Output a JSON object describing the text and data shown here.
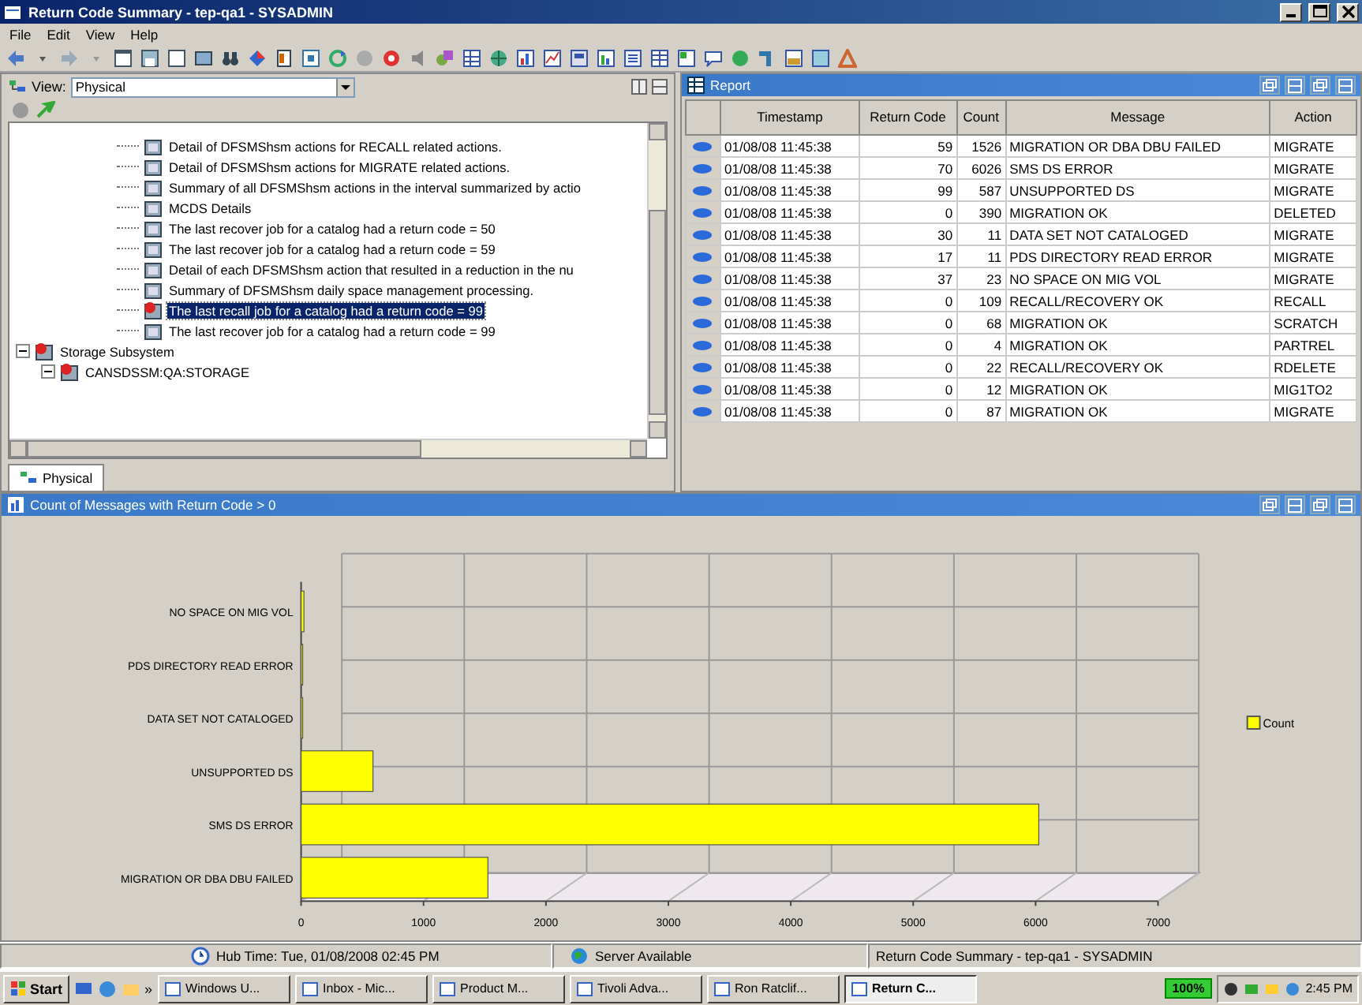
{
  "window": {
    "title": "Return Code Summary - tep-qa1 - SYSADMIN"
  },
  "menu": [
    "File",
    "Edit",
    "View",
    "Help"
  ],
  "navigator": {
    "view_label": "View:",
    "view_value": "Physical",
    "tab": {
      "label": "Physical",
      "selected": true
    },
    "tree": [
      {
        "children": [
          {
            "label": "Detail of DFSMShsm actions for RECALL related actions.",
            "kind": "report",
            "selected": false
          },
          {
            "label": "Detail of DFSMShsm actions for MIGRATE related actions.",
            "kind": "report",
            "selected": false
          },
          {
            "label": "Summary of all DFSMShsm actions in the interval summarized by actio",
            "kind": "report",
            "selected": false
          },
          {
            "label": "MCDS Details",
            "kind": "report",
            "selected": false
          },
          {
            "label": "The last recover job for a catalog had a return code = 50",
            "kind": "report",
            "selected": false
          },
          {
            "label": "The last recover job for a catalog had a return code = 59",
            "kind": "report",
            "selected": false
          },
          {
            "label": "Detail of each DFSMShsm action that resulted in a reduction in the nu",
            "kind": "report",
            "selected": false
          },
          {
            "label": "Summary of DFSMShsm daily space management processing.",
            "kind": "report",
            "selected": false
          },
          {
            "label": "The last recall job for a catalog had a return code = 99",
            "kind": "alert",
            "selected": true
          },
          {
            "label": "The last recover job for a catalog had a return code = 99",
            "kind": "report",
            "selected": false
          }
        ]
      },
      {
        "label": "Storage Subsystem",
        "kind": "alert",
        "expanded": true,
        "children": [
          {
            "label": "CANSDSSM:QA:STORAGE",
            "kind": "alert",
            "expanded": true
          }
        ]
      }
    ]
  },
  "report": {
    "title": "Report",
    "columns": [
      "Timestamp",
      "Return Code",
      "Count",
      "Message",
      "Action"
    ],
    "rows": [
      {
        "timestamp": "01/08/08 11:45:38",
        "return_code": "59",
        "count": "1526",
        "message": "MIGRATION OR DBA DBU FAILED",
        "action": "MIGRATE"
      },
      {
        "timestamp": "01/08/08 11:45:38",
        "return_code": "70",
        "count": "6026",
        "message": "SMS DS ERROR",
        "action": "MIGRATE"
      },
      {
        "timestamp": "01/08/08 11:45:38",
        "return_code": "99",
        "count": "587",
        "message": "UNSUPPORTED DS",
        "action": "MIGRATE"
      },
      {
        "timestamp": "01/08/08 11:45:38",
        "return_code": "0",
        "count": "390",
        "message": "MIGRATION OK",
        "action": "DELETED"
      },
      {
        "timestamp": "01/08/08 11:45:38",
        "return_code": "30",
        "count": "11",
        "message": "DATA SET NOT CATALOGED",
        "action": "MIGRATE"
      },
      {
        "timestamp": "01/08/08 11:45:38",
        "return_code": "17",
        "count": "11",
        "message": "PDS DIRECTORY READ ERROR",
        "action": "MIGRATE"
      },
      {
        "timestamp": "01/08/08 11:45:38",
        "return_code": "37",
        "count": "23",
        "message": "NO SPACE ON MIG VOL",
        "action": "MIGRATE"
      },
      {
        "timestamp": "01/08/08 11:45:38",
        "return_code": "0",
        "count": "109",
        "message": "RECALL/RECOVERY OK",
        "action": "RECALL"
      },
      {
        "timestamp": "01/08/08 11:45:38",
        "return_code": "0",
        "count": "68",
        "message": "MIGRATION OK",
        "action": "SCRATCH"
      },
      {
        "timestamp": "01/08/08 11:45:38",
        "return_code": "0",
        "count": "4",
        "message": "MIGRATION OK",
        "action": "PARTREL"
      },
      {
        "timestamp": "01/08/08 11:45:38",
        "return_code": "0",
        "count": "22",
        "message": "RECALL/RECOVERY OK",
        "action": "RDELETE"
      },
      {
        "timestamp": "01/08/08 11:45:38",
        "return_code": "0",
        "count": "12",
        "message": "MIGRATION OK",
        "action": "MIG1TO2"
      },
      {
        "timestamp": "01/08/08 11:45:38",
        "return_code": "0",
        "count": "87",
        "message": "MIGRATION OK",
        "action": "MIGRATE"
      }
    ]
  },
  "chart_panel": {
    "title": "Count of Messages with Return Code > 0",
    "chart_data": {
      "type": "bar",
      "orientation": "horizontal",
      "categories": [
        "NO SPACE ON MIG VOL",
        "PDS DIRECTORY READ ERROR",
        "DATA SET NOT CATALOGED",
        "UNSUPPORTED DS",
        "SMS DS ERROR",
        "MIGRATION OR DBA DBU FAILED"
      ],
      "series": [
        {
          "name": "Count",
          "color": "#ffff00",
          "values": [
            23,
            11,
            11,
            587,
            6026,
            1526
          ]
        }
      ],
      "xlim": [
        0,
        7000
      ],
      "xticks": [
        0,
        1000,
        2000,
        3000,
        4000,
        5000,
        6000,
        7000
      ]
    }
  },
  "status_bar": {
    "hub_time": "Hub Time: Tue, 01/08/2008 02:45 PM",
    "server": "Server Available",
    "workspace": "Return Code Summary - tep-qa1 - SYSADMIN"
  },
  "taskbar": {
    "start": "Start",
    "more": "»",
    "items": [
      {
        "label": "Windows U...",
        "selected": false
      },
      {
        "label": "Inbox - Mic...",
        "selected": false
      },
      {
        "label": "Product M...",
        "selected": false
      },
      {
        "label": "Tivoli Adva...",
        "selected": false
      },
      {
        "label": "Ron Ratclif...",
        "selected": false
      },
      {
        "label": "Return C...",
        "selected": true
      }
    ],
    "badge": "100%",
    "clock": "2:45 PM"
  }
}
